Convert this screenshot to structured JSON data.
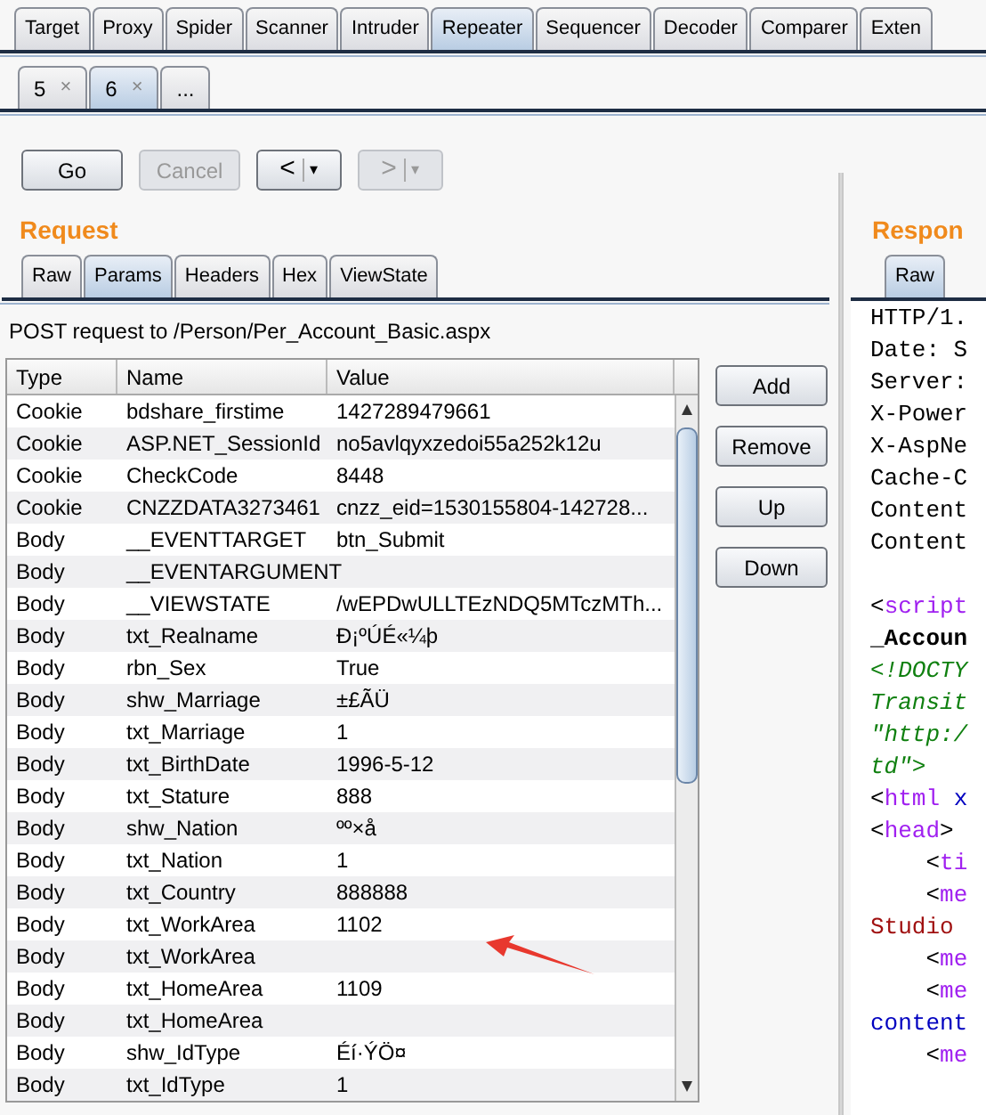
{
  "main_tabs": [
    {
      "label": "Target",
      "selected": false
    },
    {
      "label": "Proxy",
      "selected": false
    },
    {
      "label": "Spider",
      "selected": false
    },
    {
      "label": "Scanner",
      "selected": false
    },
    {
      "label": "Intruder",
      "selected": false
    },
    {
      "label": "Repeater",
      "selected": true
    },
    {
      "label": "Sequencer",
      "selected": false
    },
    {
      "label": "Decoder",
      "selected": false
    },
    {
      "label": "Comparer",
      "selected": false
    },
    {
      "label": "Exten",
      "selected": false
    }
  ],
  "sub_tabs": [
    {
      "label": "5",
      "close": "×",
      "selected": false
    },
    {
      "label": "6",
      "close": "×",
      "selected": true
    },
    {
      "label": "...",
      "selected": false
    }
  ],
  "toolbar": [
    {
      "kind": "button",
      "label": "Go",
      "disabled": false
    },
    {
      "kind": "button",
      "label": "Cancel",
      "disabled": true
    },
    {
      "kind": "split",
      "label": "<",
      "caret": "▾",
      "disabled": false
    },
    {
      "kind": "split",
      "label": ">",
      "caret": "▾",
      "disabled": true
    }
  ],
  "request": {
    "title": "Request",
    "tabs": [
      {
        "label": "Raw",
        "selected": false
      },
      {
        "label": "Params",
        "selected": true
      },
      {
        "label": "Headers",
        "selected": false
      },
      {
        "label": "Hex",
        "selected": false
      },
      {
        "label": "ViewState",
        "selected": false
      }
    ],
    "summary": "POST request to /Person/Per_Account_Basic.aspx",
    "table": {
      "columns": [
        "Type",
        "Name",
        "Value"
      ],
      "rows": [
        [
          "Cookie",
          "bdshare_firstime",
          "1427289479661"
        ],
        [
          "Cookie",
          "ASP.NET_SessionId",
          "no5avlqyxzedoi55a252k12u"
        ],
        [
          "Cookie",
          "CheckCode",
          "8448"
        ],
        [
          "Cookie",
          "CNZZDATA3273461",
          "cnzz_eid=1530155804-142728..."
        ],
        [
          "Body",
          "__EVENTTARGET",
          "btn_Submit"
        ],
        [
          "Body",
          "__EVENTARGUMENT",
          ""
        ],
        [
          "Body",
          "__VIEWSTATE",
          "/wEPDwULLTEzNDQ5MTczMTh..."
        ],
        [
          "Body",
          "txt_Realname",
          "Ð¡ºÚÉ«¼þ"
        ],
        [
          "Body",
          "rbn_Sex",
          "True"
        ],
        [
          "Body",
          "shw_Marriage",
          "±£ÃÜ"
        ],
        [
          "Body",
          "txt_Marriage",
          "1"
        ],
        [
          "Body",
          "txt_BirthDate",
          "1996-5-12"
        ],
        [
          "Body",
          "txt_Stature",
          "888"
        ],
        [
          "Body",
          "shw_Nation",
          "ºº×å"
        ],
        [
          "Body",
          "txt_Nation",
          "1"
        ],
        [
          "Body",
          "txt_Country",
          "888888"
        ],
        [
          "Body",
          "txt_WorkArea",
          "1102"
        ],
        [
          "Body",
          "txt_WorkArea",
          ""
        ],
        [
          "Body",
          "txt_HomeArea",
          "1109"
        ],
        [
          "Body",
          "txt_HomeArea",
          ""
        ],
        [
          "Body",
          "shw_IdType",
          "Éí·ÝÖ¤"
        ],
        [
          "Body",
          "txt_IdType",
          "1"
        ]
      ]
    },
    "side_buttons": [
      "Add",
      "Remove",
      "Up",
      "Down"
    ]
  },
  "response": {
    "title": "Respon",
    "tabs": [
      {
        "label": "Raw",
        "selected": true
      }
    ],
    "lines": [
      {
        "kind": "code",
        "segments": [
          {
            "t": "HTTP/1.",
            "kind": "plain"
          }
        ]
      },
      {
        "kind": "code",
        "segments": [
          {
            "t": "Date: S",
            "kind": "plain"
          }
        ]
      },
      {
        "kind": "code",
        "segments": [
          {
            "t": "Server:",
            "kind": "plain"
          }
        ]
      },
      {
        "kind": "code",
        "segments": [
          {
            "t": "X-Power",
            "kind": "plain"
          }
        ]
      },
      {
        "kind": "code",
        "segments": [
          {
            "t": "X-AspNe",
            "kind": "plain"
          }
        ]
      },
      {
        "kind": "code",
        "segments": [
          {
            "t": "Cache-C",
            "kind": "plain"
          }
        ]
      },
      {
        "kind": "code",
        "segments": [
          {
            "t": "Content",
            "kind": "plain"
          }
        ]
      },
      {
        "kind": "code",
        "segments": [
          {
            "t": "Content",
            "kind": "plain"
          }
        ]
      },
      {
        "kind": "blank"
      },
      {
        "kind": "code",
        "segments": [
          {
            "t": "<",
            "kind": "plain"
          },
          {
            "t": "script",
            "kind": "tag"
          }
        ]
      },
      {
        "kind": "code",
        "segments": [
          {
            "t": "_Accoun",
            "kind": "bold"
          }
        ]
      },
      {
        "kind": "code",
        "segments": [
          {
            "t": "<!DOCTY",
            "kind": "comment"
          }
        ]
      },
      {
        "kind": "code",
        "segments": [
          {
            "t": "Transit",
            "kind": "comment"
          }
        ]
      },
      {
        "kind": "code",
        "segments": [
          {
            "t": "\"http:/",
            "kind": "comment"
          }
        ]
      },
      {
        "kind": "code",
        "segments": [
          {
            "t": "td\">",
            "kind": "comment"
          }
        ]
      },
      {
        "kind": "code",
        "segments": [
          {
            "t": "<",
            "kind": "plain"
          },
          {
            "t": "html",
            "kind": "tag"
          },
          {
            "t": " x",
            "kind": "attr"
          }
        ]
      },
      {
        "kind": "code",
        "segments": [
          {
            "t": "<",
            "kind": "plain"
          },
          {
            "t": "head",
            "kind": "tag"
          },
          {
            "t": ">",
            "kind": "plain"
          }
        ]
      },
      {
        "kind": "code",
        "segments": [
          {
            "t": "    <",
            "kind": "plain"
          },
          {
            "t": "ti",
            "kind": "tag"
          }
        ]
      },
      {
        "kind": "code",
        "segments": [
          {
            "t": "    <",
            "kind": "plain"
          },
          {
            "t": "me",
            "kind": "tag"
          }
        ]
      },
      {
        "kind": "code",
        "segments": [
          {
            "t": "Studio",
            "kind": "string"
          }
        ]
      },
      {
        "kind": "code",
        "segments": [
          {
            "t": "    <",
            "kind": "plain"
          },
          {
            "t": "me",
            "kind": "tag"
          }
        ]
      },
      {
        "kind": "code",
        "segments": [
          {
            "t": "    <",
            "kind": "plain"
          },
          {
            "t": "me",
            "kind": "tag"
          }
        ]
      },
      {
        "kind": "code",
        "segments": [
          {
            "t": "content",
            "kind": "attr"
          }
        ]
      },
      {
        "kind": "code",
        "segments": [
          {
            "t": "    <",
            "kind": "plain"
          },
          {
            "t": "me",
            "kind": "tag"
          }
        ]
      }
    ]
  }
}
